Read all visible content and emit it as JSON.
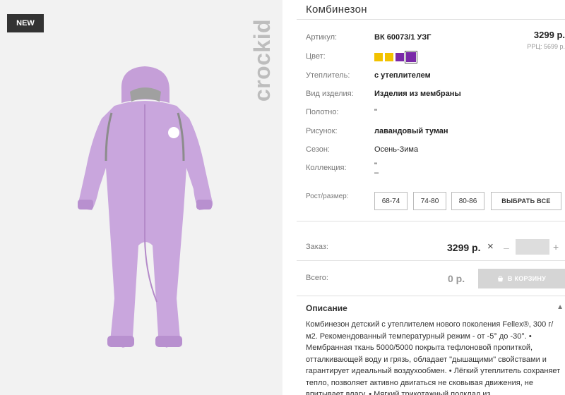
{
  "image_pane": {
    "badge": "NEW",
    "brand": "crockid",
    "product_color": "#c9a6dd"
  },
  "product": {
    "title": "Комбинезон",
    "price": "3299 р.",
    "rrp": "РРЦ: 5699 р.",
    "attributes": [
      {
        "label": "Артикул:",
        "value": "ВК 60073/1 УЗГ",
        "bold": true
      },
      {
        "label": "Цвет:",
        "value": "",
        "bold": false
      },
      {
        "label": "Утеплитель:",
        "value": "с утеплителем",
        "bold": true
      },
      {
        "label": "Вид изделия:",
        "value": "Изделия из мембраны",
        "bold": true
      },
      {
        "label": "Полотно:",
        "value": "\"",
        "bold": false
      },
      {
        "label": "Рисунок:",
        "value": "лавандовый туман",
        "bold": true
      },
      {
        "label": "Сезон:",
        "value": "Осень-Зима",
        "bold": false
      },
      {
        "label": "Коллекция:",
        "value": "\"\n–",
        "bold": false
      }
    ],
    "swatches": [
      {
        "color": "#f2c200",
        "selected": false
      },
      {
        "color": "#f2c200",
        "selected": false
      },
      {
        "color": "#7a2aa8",
        "selected": false
      },
      {
        "color": "#7a2aa8",
        "selected": true
      }
    ],
    "size_label": "Рост/размер:",
    "sizes": [
      "68-74",
      "74-80",
      "80-86"
    ],
    "select_all": "ВЫБРАТЬ ВСЕ"
  },
  "order": {
    "label": "Заказ:",
    "price": "3299 р.",
    "times": "×",
    "minus": "–",
    "plus": "+",
    "quantity": "",
    "total_label": "Всего:",
    "total": "0 р.",
    "cart_button": "В КОРЗИНУ"
  },
  "description": {
    "title": "Описание",
    "text": "Комбинезон детский с утеплителем нового поколения Fellex®, 300 г/м2. Рекомендованный температурный режим - от -5° до -30°. • Мембранная ткань 5000/5000 покрыта тефлоновой пропиткой, отталкивающей воду и грязь, обладает \"дышащими\" свойствами и гарантирует идеальный воздухообмен. • Лёгкий утеплитель сохраняет тепло, позволяет активно двигаться не сковывая движения, не впитывает влагу. • Мягкий трикотажный подклад из"
  }
}
